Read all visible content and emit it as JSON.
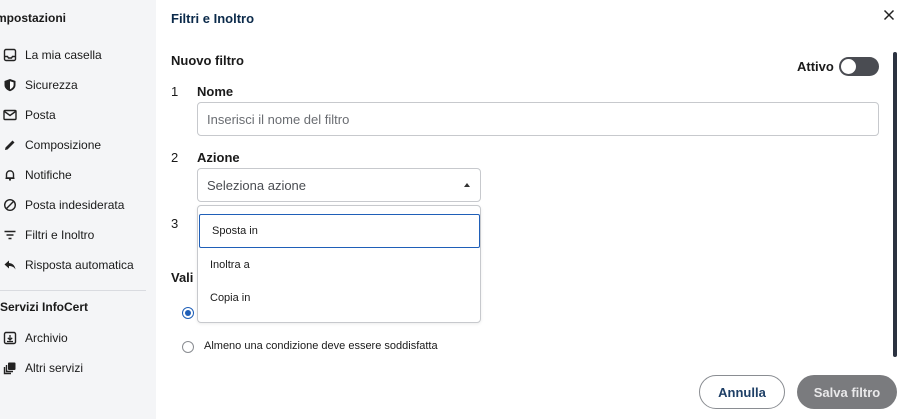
{
  "sidebar": {
    "title": "mpostazioni",
    "items": [
      {
        "label": "La mia casella",
        "icon": "inbox-icon"
      },
      {
        "label": "Sicurezza",
        "icon": "shield-icon"
      },
      {
        "label": "Posta",
        "icon": "mail-icon"
      },
      {
        "label": "Composizione",
        "icon": "pencil-icon"
      },
      {
        "label": "Notifiche",
        "icon": "bell-icon"
      },
      {
        "label": "Posta indesiderata",
        "icon": "block-icon"
      },
      {
        "label": "Filtri e Inoltro",
        "icon": "filter-icon"
      },
      {
        "label": "Risposta automatica",
        "icon": "reply-icon"
      }
    ],
    "section_title": "Servizi InfoCert",
    "section_items": [
      {
        "label": "Archivio",
        "icon": "archive-icon"
      },
      {
        "label": "Altri servizi",
        "icon": "services-icon"
      }
    ]
  },
  "main": {
    "title": "Filtri e Inoltro",
    "close_icon": "close-icon",
    "nuovo_filtro": "Nuovo filtro",
    "attivo_label": "Attivo",
    "attivo_on": false,
    "steps": [
      {
        "num": "1",
        "label": "Nome"
      },
      {
        "num": "2",
        "label": "Azione"
      },
      {
        "num": "3",
        "label": ""
      }
    ],
    "name_placeholder": "Inserisci il nome del filtro",
    "name_value": "",
    "action_placeholder": "Seleziona azione",
    "action_options": [
      "Sposta in",
      "Inoltra a",
      "Copia in"
    ],
    "action_highlighted": "Sposta in",
    "validity_label": "Vali",
    "radio_options": [
      {
        "label": "",
        "selected": true
      },
      {
        "label": "Almeno una condizione deve essere soddisfatta",
        "selected": false
      }
    ],
    "cancel_label": "Annulla",
    "save_label": "Salva filtro"
  },
  "colors": {
    "sidebar_bg": "#f4f5f7",
    "accent_blue": "#1f5fb8",
    "title_navy": "#0b2a4a",
    "save_disabled": "#7a7b7e",
    "toggle_off": "#4a4c52"
  }
}
